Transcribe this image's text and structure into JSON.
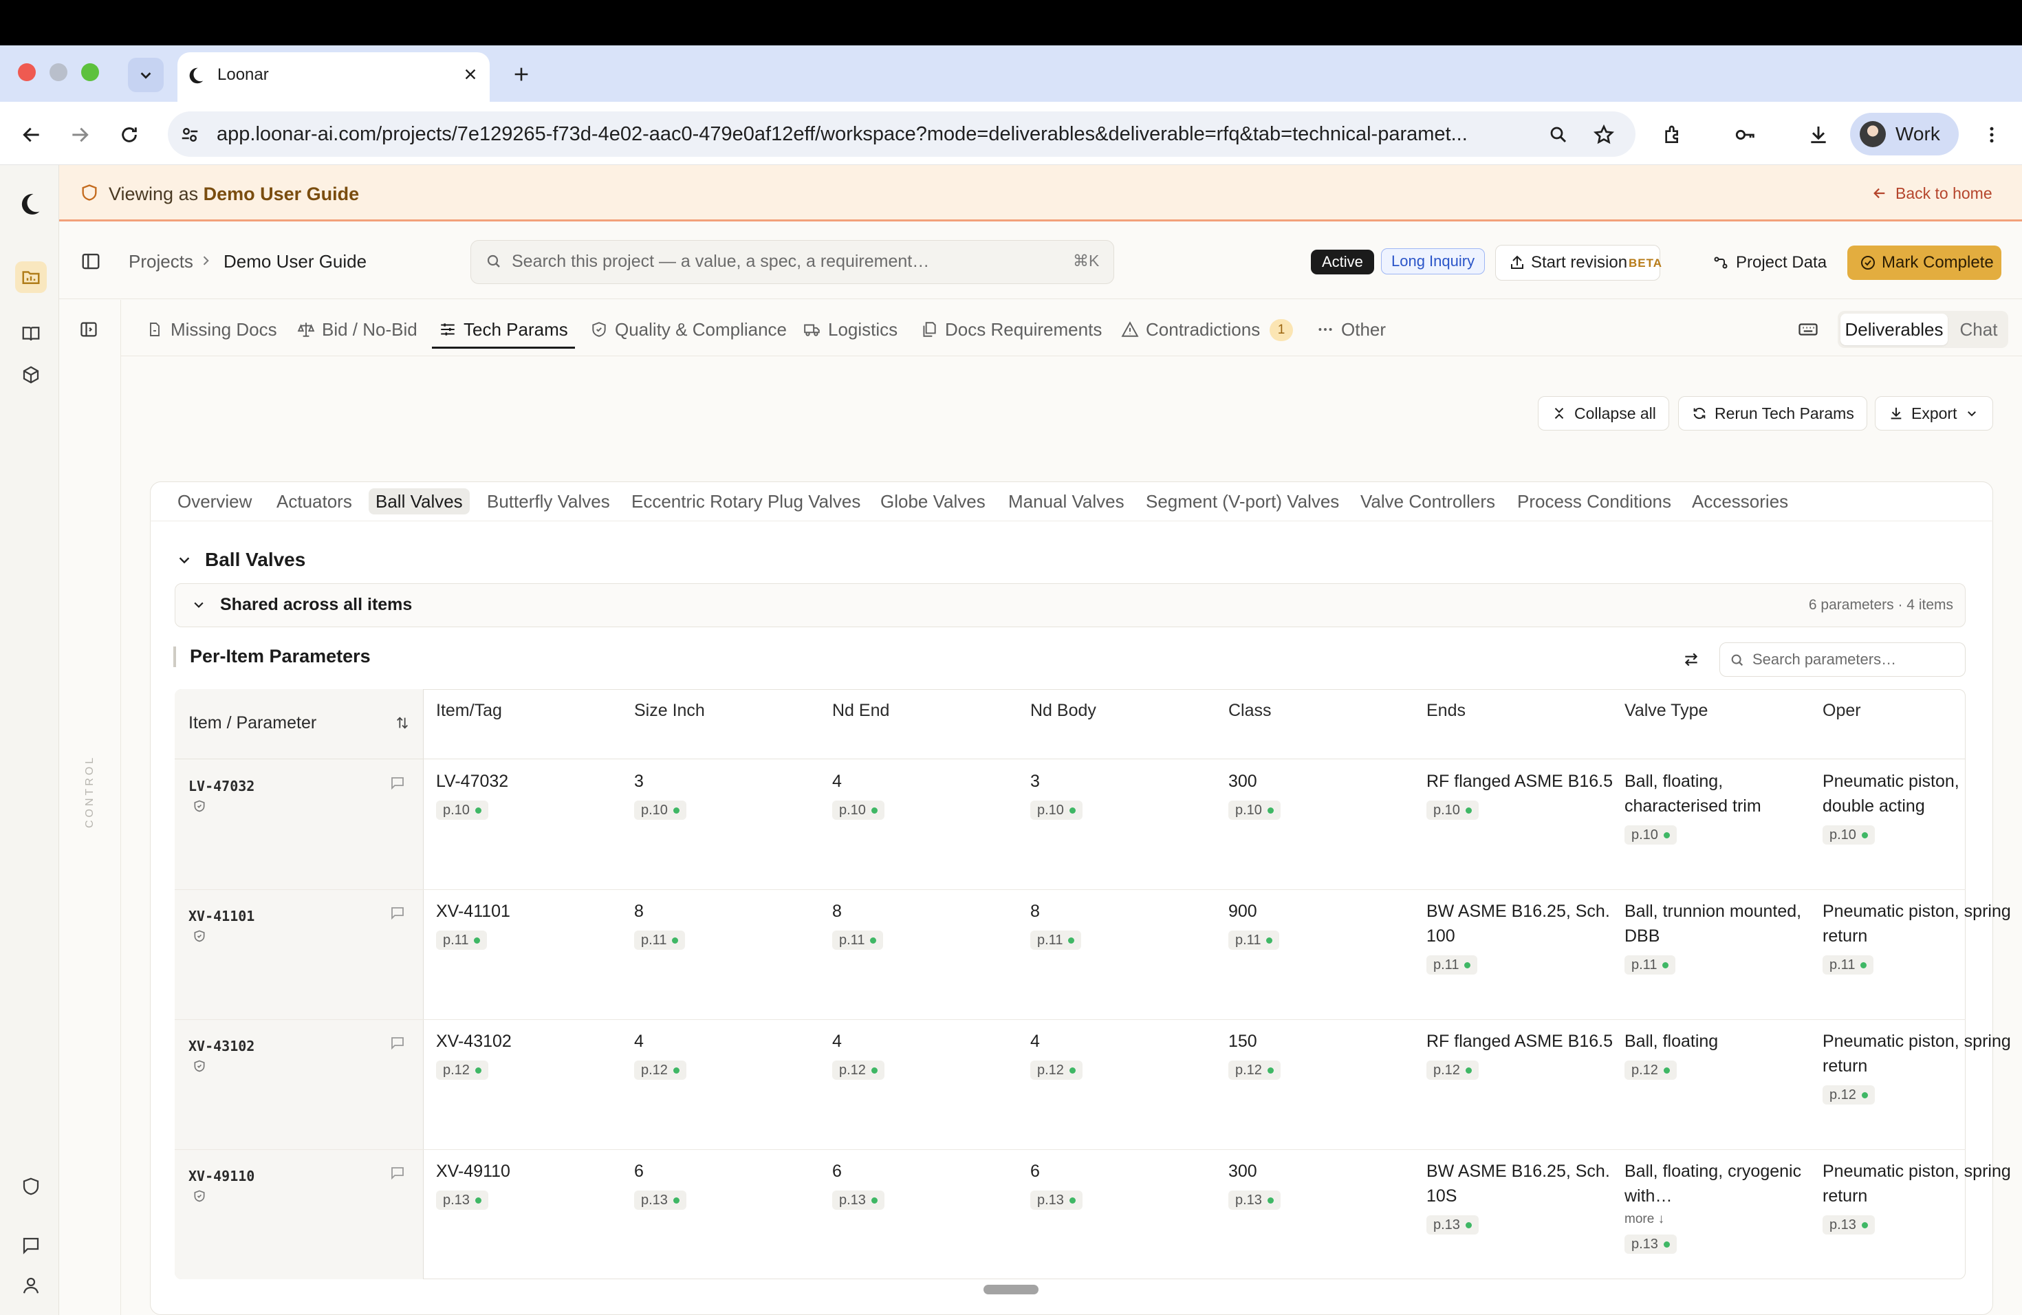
{
  "browser": {
    "tab_title": "Loonar",
    "url": "app.loonar-ai.com/projects/7e129265-f73d-4e02-aac0-479e0af12eff/workspace?mode=deliverables&deliverable=rfq&tab=technical-paramet...",
    "profile_label": "Work"
  },
  "banner": {
    "prefix": "Viewing as",
    "user": "Demo User Guide",
    "back_link": "Back to home"
  },
  "header": {
    "crumb_projects": "Projects",
    "crumb_current": "Demo User Guide",
    "search_placeholder": "Search this project — a value, a spec, a requirement…",
    "search_shortcut": "⌘K",
    "badge_status": "Active",
    "badge_type": "Long Inquiry",
    "start_revision": "Start revision",
    "beta": "BETA",
    "project_data": "Project Data",
    "mark_complete": "Mark Complete"
  },
  "section_tabs": [
    {
      "label": "Missing Docs"
    },
    {
      "label": "Bid / No-Bid"
    },
    {
      "label": "Tech Params"
    },
    {
      "label": "Quality & Compliance"
    },
    {
      "label": "Logistics"
    },
    {
      "label": "Docs Requirements"
    },
    {
      "label": "Contradictions",
      "count": "1"
    },
    {
      "label": "Other"
    }
  ],
  "view_toggle": {
    "deliverables": "Deliverables",
    "chat": "Chat"
  },
  "side_label": "CONTROL",
  "actions": {
    "collapse_all": "Collapse all",
    "rerun": "Rerun Tech Params",
    "export": "Export"
  },
  "sub_tabs": [
    "Overview",
    "Actuators",
    "Ball Valves",
    "Butterfly Valves",
    "Eccentric Rotary Plug Valves",
    "Globe Valves",
    "Manual Valves",
    "Segment (V-port) Valves",
    "Valve Controllers",
    "Process Conditions",
    "Accessories"
  ],
  "section": {
    "title": "Ball Valves",
    "shared_title": "Shared across all items",
    "shared_meta": "6 parameters · 4 items",
    "per_item_title": "Per-Item Parameters",
    "param_search_placeholder": "Search parameters…"
  },
  "table": {
    "first_col_header": "Item / Parameter",
    "columns": [
      "Item/Tag",
      "Size Inch",
      "Nd End",
      "Nd Body",
      "Class",
      "Ends",
      "Valve Type",
      "Oper"
    ],
    "rows": [
      {
        "tag": "LV-47032",
        "cells": [
          {
            "v": "LV-47032",
            "p": "p.10"
          },
          {
            "v": "3",
            "p": "p.10"
          },
          {
            "v": "4",
            "p": "p.10"
          },
          {
            "v": "3",
            "p": "p.10"
          },
          {
            "v": "300",
            "p": "p.10"
          },
          {
            "v": "RF flanged ASME B16.5",
            "p": "p.10"
          },
          {
            "v": "Ball, floating, characterised trim",
            "p": "p.10"
          },
          {
            "v": "Pneumatic piston, double acting",
            "p": "p.10"
          }
        ]
      },
      {
        "tag": "XV-41101",
        "cells": [
          {
            "v": "XV-41101",
            "p": "p.11"
          },
          {
            "v": "8",
            "p": "p.11"
          },
          {
            "v": "8",
            "p": "p.11"
          },
          {
            "v": "8",
            "p": "p.11"
          },
          {
            "v": "900",
            "p": "p.11"
          },
          {
            "v": "BW ASME B16.25, Sch. 100",
            "p": "p.11"
          },
          {
            "v": "Ball, trunnion mounted, DBB",
            "p": "p.11"
          },
          {
            "v": "Pneumatic piston, spring return",
            "p": "p.11"
          }
        ]
      },
      {
        "tag": "XV-43102",
        "cells": [
          {
            "v": "XV-43102",
            "p": "p.12"
          },
          {
            "v": "4",
            "p": "p.12"
          },
          {
            "v": "4",
            "p": "p.12"
          },
          {
            "v": "4",
            "p": "p.12"
          },
          {
            "v": "150",
            "p": "p.12"
          },
          {
            "v": "RF flanged ASME B16.5",
            "p": "p.12"
          },
          {
            "v": "Ball, floating",
            "p": "p.12"
          },
          {
            "v": "Pneumatic piston, spring return",
            "p": "p.12"
          }
        ]
      },
      {
        "tag": "XV-49110",
        "cells": [
          {
            "v": "XV-49110",
            "p": "p.13"
          },
          {
            "v": "6",
            "p": "p.13"
          },
          {
            "v": "6",
            "p": "p.13"
          },
          {
            "v": "6",
            "p": "p.13"
          },
          {
            "v": "300",
            "p": "p.13"
          },
          {
            "v": "BW ASME B16.25, Sch. 10S",
            "p": "p.13"
          },
          {
            "v": "Ball, floating, cryogenic with…",
            "p": "p.13",
            "more": "more ↓"
          },
          {
            "v": "Pneumatic piston, spring return",
            "p": "p.13"
          }
        ]
      }
    ]
  },
  "colors": {
    "accent": "#e3ad3f",
    "banner_bg": "#fdf1e3",
    "status_dot": "#3fb765"
  }
}
